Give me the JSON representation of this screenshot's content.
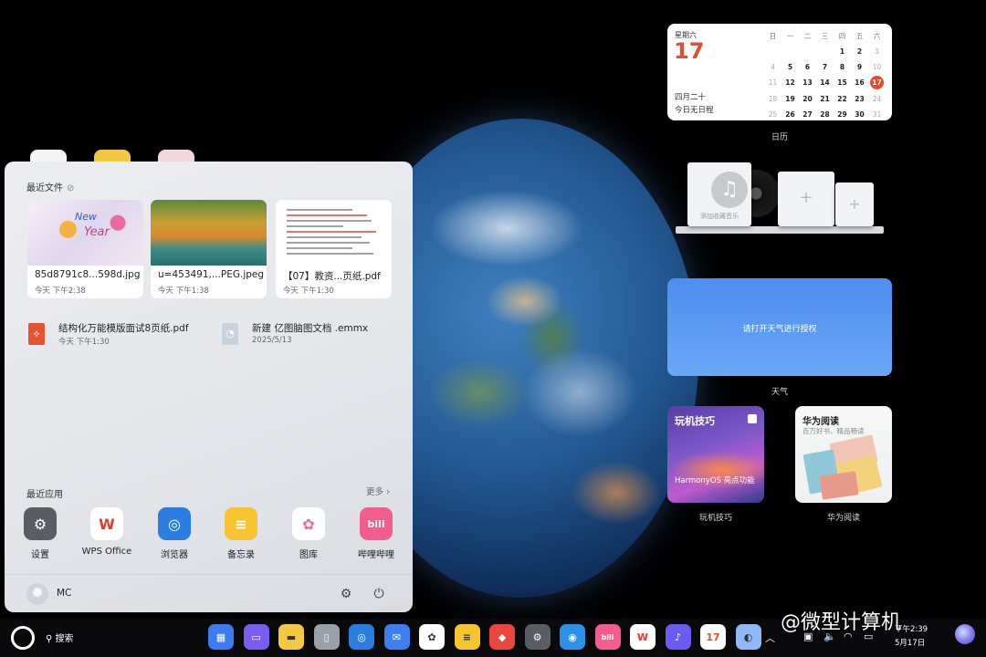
{
  "start_menu": {
    "recent_files_title": "最近文件",
    "recent_files_cards": [
      {
        "name": "85d8791c8...598d.jpg",
        "time": "今天 下午2:38"
      },
      {
        "name": "u=453491,...PEG.jpeg",
        "time": "今天 下午1:38"
      },
      {
        "name": "【07】教资...页纸.pdf",
        "time": "今天 下午1:30"
      }
    ],
    "card_drawing_text": [
      "New",
      "Year"
    ],
    "recent_files_list": [
      {
        "name": "结构化万能模版面试8页纸.pdf",
        "time": "今天 下午1:30"
      },
      {
        "name": "新建 亿图脑图文档 .emmx",
        "time": "2025/5/13"
      }
    ],
    "recent_apps_title": "最近应用",
    "more_label": "更多",
    "apps": [
      {
        "label": "设置",
        "glyph": "⚙",
        "color": "#5a5d63"
      },
      {
        "label": "WPS Office",
        "glyph": "W",
        "color": "#ffffff"
      },
      {
        "label": "浏览器",
        "glyph": "◎",
        "color": "#2a7de1"
      },
      {
        "label": "备忘录",
        "glyph": "≡",
        "color": "#f6c431"
      },
      {
        "label": "图库",
        "glyph": "✿",
        "color": "#ffffff"
      },
      {
        "label": "哔哩哔哩",
        "glyph": "bili",
        "color": "#f25d8e"
      }
    ],
    "user_name": "MC"
  },
  "calendar": {
    "weekday": "星期六",
    "day": "17",
    "lunar": "四月二十",
    "schedule": "今日无日程",
    "headers": [
      "日",
      "一",
      "二",
      "三",
      "四",
      "五",
      "六"
    ],
    "rows": [
      [
        "",
        "",
        "",
        "",
        "1",
        "2",
        "3"
      ],
      [
        "4",
        "5",
        "6",
        "7",
        "8",
        "9",
        "10"
      ],
      [
        "11",
        "12",
        "13",
        "14",
        "15",
        "16",
        "17"
      ],
      [
        "18",
        "19",
        "20",
        "21",
        "22",
        "23",
        "24"
      ],
      [
        "25",
        "26",
        "27",
        "28",
        "29",
        "30",
        "31"
      ]
    ],
    "label": "日历"
  },
  "music_widget": {
    "album_label": "添加收藏音乐",
    "plus": "+"
  },
  "weather_widget": {
    "text": "请打开天气进行授权",
    "label": "天气"
  },
  "tips_widget": {
    "title": "玩机技巧",
    "subtitle": "HarmonyOS 亮点功能",
    "label": "玩机技巧"
  },
  "reading_widget": {
    "title": "华为阅读",
    "subtitle": "百万好书，精品畅读",
    "label": "华为阅读"
  },
  "taskbar": {
    "search_label": "搜索",
    "clock_time": "下午2:39",
    "clock_date": "5月17日",
    "apps": [
      {
        "name": "app-center",
        "glyph": "▦",
        "color": "#3a7bf0"
      },
      {
        "name": "multitask",
        "glyph": "▭",
        "color": "#7b5cf0"
      },
      {
        "name": "files",
        "glyph": "▬",
        "color": "#f5c842"
      },
      {
        "name": "recycle-bin",
        "glyph": "▯",
        "color": "#9aa0a8"
      },
      {
        "name": "browser",
        "glyph": "◎",
        "color": "#2a7de1"
      },
      {
        "name": "mail",
        "glyph": "✉",
        "color": "#3d7ef0"
      },
      {
        "name": "gallery",
        "glyph": "✿",
        "color": "#ffffff"
      },
      {
        "name": "notes",
        "glyph": "≡",
        "color": "#f6c431"
      },
      {
        "name": "app-gallery",
        "glyph": "◆",
        "color": "#e8463f"
      },
      {
        "name": "settings",
        "glyph": "⚙",
        "color": "#5a5d63"
      },
      {
        "name": "photo-app",
        "glyph": "◉",
        "color": "#2c8fe8"
      },
      {
        "name": "bilibili",
        "glyph": "bili",
        "color": "#f25d8e"
      },
      {
        "name": "wps",
        "glyph": "W",
        "color": "#ffffff"
      },
      {
        "name": "music",
        "glyph": "♪",
        "color": "#6a5cf0"
      },
      {
        "name": "calendar",
        "glyph": "17",
        "color": "#ffffff"
      },
      {
        "name": "browser-alt",
        "glyph": "◐",
        "color": "#8fb8f8"
      }
    ]
  },
  "watermark": "@微型计算机"
}
